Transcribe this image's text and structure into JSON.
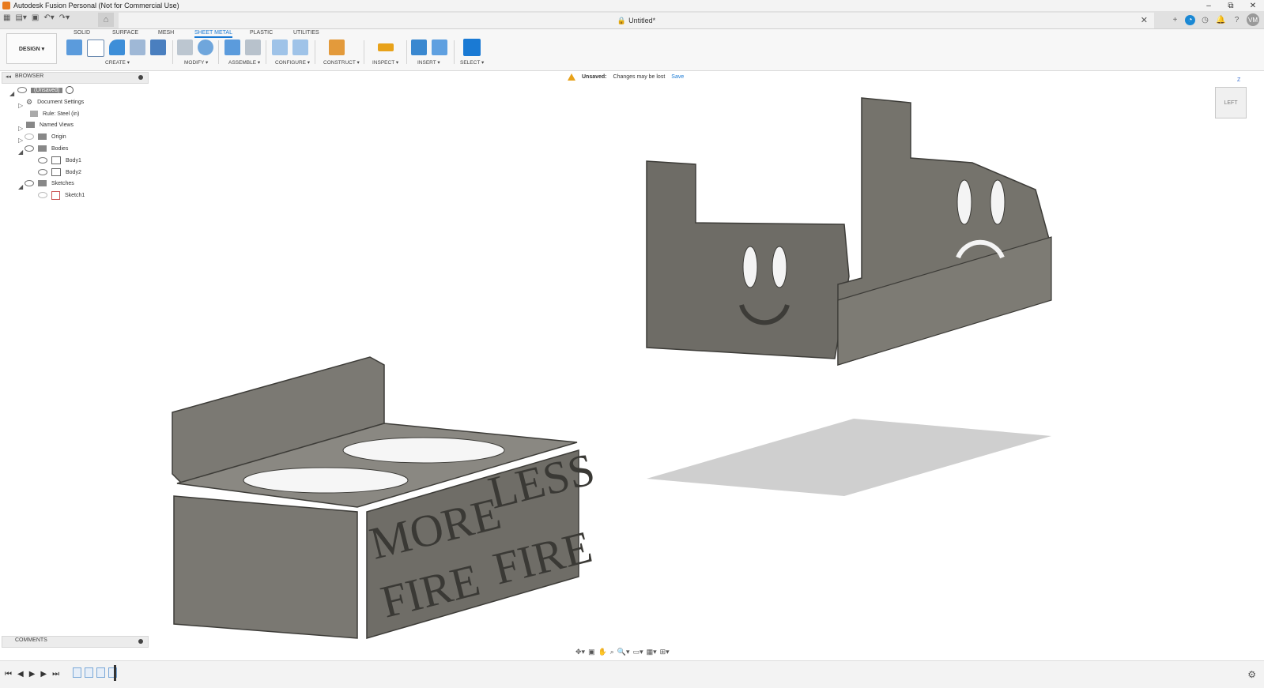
{
  "window": {
    "title": "Autodesk Fusion Personal (Not for Commercial Use)",
    "minimize": "–",
    "maximize": "⧉",
    "close": "✕"
  },
  "document": {
    "tab_title": "Untitled*",
    "close": "✕",
    "lock_icon": "lock-icon"
  },
  "header_icons": {
    "avatar": "VM"
  },
  "workspace": {
    "label": "DESIGN ▾"
  },
  "ribbon_tabs": [
    "SOLID",
    "SURFACE",
    "MESH",
    "SHEET METAL",
    "PLASTIC",
    "UTILITIES"
  ],
  "active_tab": "SHEET METAL",
  "groups": {
    "create": "CREATE ▾",
    "modify": "MODIFY ▾",
    "assemble": "ASSEMBLE ▾",
    "configure": "CONFIGURE ▾",
    "construct": "CONSTRUCT ▾",
    "inspect": "INSPECT ▾",
    "insert": "INSERT ▾",
    "select": "SELECT ▾"
  },
  "browser": {
    "title": "BROWSER",
    "root": "(Unsaved)",
    "items": {
      "document_settings": "Document Settings",
      "rule": "Rule: Steel (in)",
      "named_views": "Named Views",
      "origin": "Origin",
      "bodies": "Bodies",
      "body1": "Body1",
      "body2": "Body2",
      "sketches": "Sketches",
      "sketch1": "Sketch1"
    }
  },
  "banner": {
    "label": "Unsaved:",
    "message": "Changes may be lost",
    "action": "Save"
  },
  "viewcube": {
    "face": "LEFT",
    "axis_z": "Z"
  },
  "comments": {
    "title": "COMMENTS"
  },
  "model_text": {
    "left_top": "MORE",
    "left_bottom": "FIRE",
    "right_top": "LESS",
    "right_bottom": "FIRE"
  }
}
